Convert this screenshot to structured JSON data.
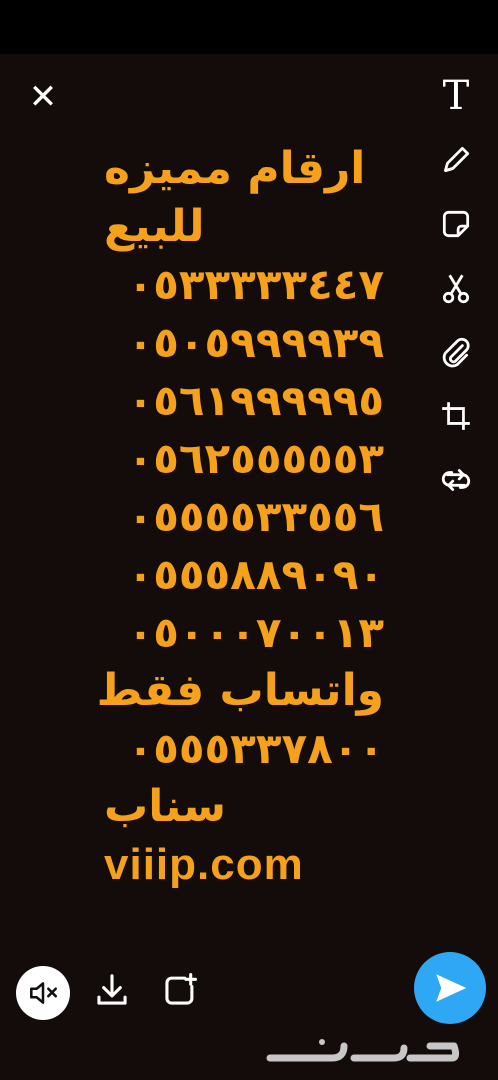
{
  "toolbar": {
    "close_glyph": "✕",
    "text_tool_glyph": "T",
    "items": [
      "text-tool-icon",
      "pencil-icon",
      "sticker-icon",
      "scissors-icon",
      "paperclip-icon",
      "crop-icon",
      "loop-icon"
    ]
  },
  "caption": {
    "title_line1": "ارقام مميزه",
    "title_line2": "للبيع",
    "numbers": [
      "٠٥٣٣٣٣٣٤٤٧",
      "٠٥٠٥٩٩٩٩٣٩",
      "٠٥٦١٩٩٩٩٩٥",
      "٠٥٦٢٥٥٥٥٥٣",
      "٠٥٥٥٥٣٣٥٥٦",
      "٠٥٥٥٨٨٩٠٩٠",
      "٠٥٠٠٠٧٠٠١٣"
    ],
    "whatsapp_label": "واتساب فقط",
    "whatsapp_number": "٠٥٥٥٣٣٧٨٠٠",
    "snap_label": "سناب",
    "website": "viiip.com"
  },
  "colors": {
    "text": "#f5a11c",
    "background": "#140c0a",
    "send_button": "#2ea8f4"
  },
  "watermark": {
    "text": "حراج"
  }
}
